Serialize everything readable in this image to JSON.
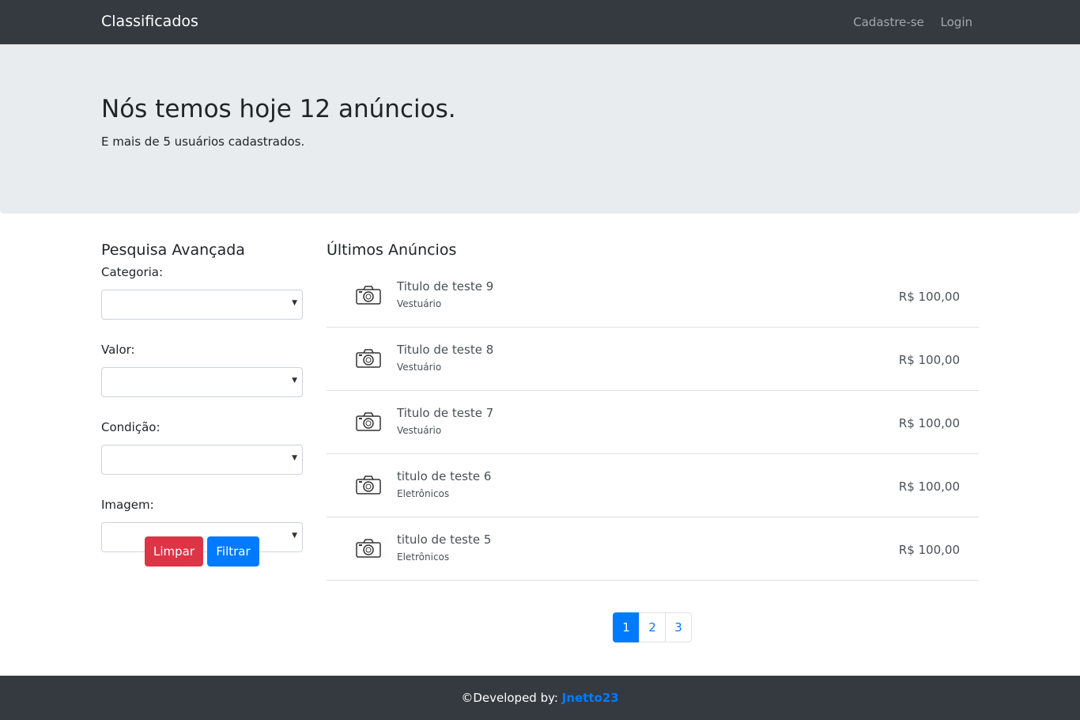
{
  "navbar": {
    "brand": "Classificados",
    "links": [
      "Cadastre-se",
      "Login"
    ]
  },
  "hero": {
    "title": "Nós temos hoje 12 anúncios.",
    "subtitle": "E mais de 5 usuários cadastrados."
  },
  "search": {
    "title": "Pesquisa Avançada",
    "fields": [
      {
        "label": "Categoria:",
        "value": ""
      },
      {
        "label": "Valor:",
        "value": ""
      },
      {
        "label": "Condição:",
        "value": ""
      },
      {
        "label": "Imagem:",
        "value": ""
      }
    ],
    "clear_label": "Limpar",
    "filter_label": "Filtrar"
  },
  "ads": {
    "title": "Últimos Anúncios",
    "items": [
      {
        "title": "Titulo de teste 9",
        "category": "Vestuário",
        "price": "R$ 100,00",
        "icon": "camera-icon"
      },
      {
        "title": "Titulo de teste 8",
        "category": "Vestuário",
        "price": "R$ 100,00",
        "icon": "camera-icon"
      },
      {
        "title": "Titulo de teste 7",
        "category": "Vestuário",
        "price": "R$ 100,00",
        "icon": "camera-icon"
      },
      {
        "title": "titulo de teste 6",
        "category": "Eletrônicos",
        "price": "R$ 100,00",
        "icon": "camera-icon"
      },
      {
        "title": "titulo de teste 5",
        "category": "Eletrônicos",
        "price": "R$ 100,00",
        "icon": "camera-icon"
      }
    ]
  },
  "pagination": {
    "pages": [
      "1",
      "2",
      "3"
    ],
    "active_page": "1"
  },
  "footer": {
    "prefix": "©Developed by:",
    "author": "Jnetto23"
  },
  "colors": {
    "navbar_bg": "#343a40",
    "hero_bg": "#e9ecef",
    "primary": "#007bff",
    "danger": "#dc3545"
  }
}
